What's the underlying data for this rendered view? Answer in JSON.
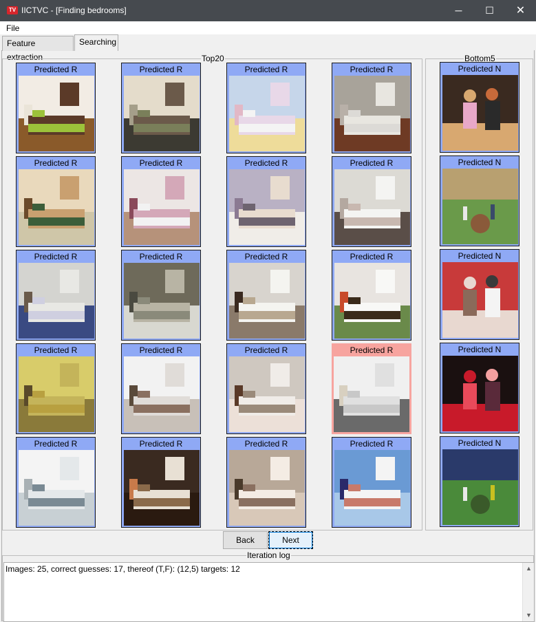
{
  "window": {
    "title": "IICTVC - [Finding bedrooms]",
    "controls": {
      "minimize": "─",
      "maximize": "☐",
      "close": "✕"
    }
  },
  "menu": {
    "file": "File"
  },
  "tabs": [
    {
      "label": "Feature extraction",
      "active": false
    },
    {
      "label": "Searching",
      "active": true
    }
  ],
  "top": {
    "label": "Top20",
    "cards": [
      {
        "label": "Predicted R",
        "status": "correct",
        "scene": "bedroom-warm"
      },
      {
        "label": "Predicted R",
        "status": "correct",
        "scene": "bedroom-iron"
      },
      {
        "label": "Predicted R",
        "status": "correct",
        "scene": "kids-room"
      },
      {
        "label": "Predicted R",
        "status": "correct",
        "scene": "bedroom-wood"
      },
      {
        "label": "Predicted R",
        "status": "correct",
        "scene": "attic-room"
      },
      {
        "label": "Predicted R",
        "status": "correct",
        "scene": "bedroom-pink"
      },
      {
        "label": "Predicted R",
        "status": "correct",
        "scene": "bedroom-violet"
      },
      {
        "label": "Predicted R",
        "status": "correct",
        "scene": "bedroom-iron-white"
      },
      {
        "label": "Predicted R",
        "status": "correct",
        "scene": "bedroom-fan"
      },
      {
        "label": "Predicted R",
        "status": "correct",
        "scene": "bedroom-grey"
      },
      {
        "label": "Predicted R",
        "status": "correct",
        "scene": "canopy-bed"
      },
      {
        "label": "Predicted R",
        "status": "correct",
        "scene": "bedroom-floral"
      },
      {
        "label": "Predicted R",
        "status": "correct",
        "scene": "bedroom-yellow"
      },
      {
        "label": "Predicted R",
        "status": "correct",
        "scene": "bedroom-white"
      },
      {
        "label": "Predicted R",
        "status": "correct",
        "scene": "bedroom-dark-floor"
      },
      {
        "label": "Predicted R",
        "status": "wrong",
        "scene": "bathroom"
      },
      {
        "label": "Predicted R",
        "status": "correct",
        "scene": "bathroom-white"
      },
      {
        "label": "Predicted R",
        "status": "correct",
        "scene": "bedroom-dark"
      },
      {
        "label": "Predicted R",
        "status": "correct",
        "scene": "bedroom-modern"
      },
      {
        "label": "Predicted R",
        "status": "correct",
        "scene": "kids-sky"
      }
    ]
  },
  "bottom": {
    "label": "Bottom5",
    "cards": [
      {
        "label": "Predicted N",
        "status": "correct",
        "scene": "dancers"
      },
      {
        "label": "Predicted N",
        "status": "correct",
        "scene": "baseball"
      },
      {
        "label": "Predicted N",
        "status": "correct",
        "scene": "crowd"
      },
      {
        "label": "Predicted N",
        "status": "correct",
        "scene": "concert"
      },
      {
        "label": "Predicted N",
        "status": "correct",
        "scene": "stadium"
      }
    ]
  },
  "buttons": {
    "back": "Back",
    "next": "Next"
  },
  "log": {
    "label": "Iteration log",
    "text": "Images: 25, correct guesses: 17, thereof (T,F): (12,5) targets: 12"
  },
  "colors": {
    "correct_frame": "#8fa9f5",
    "wrong_frame": "#f7a49f",
    "titlebar": "#464a4f"
  }
}
